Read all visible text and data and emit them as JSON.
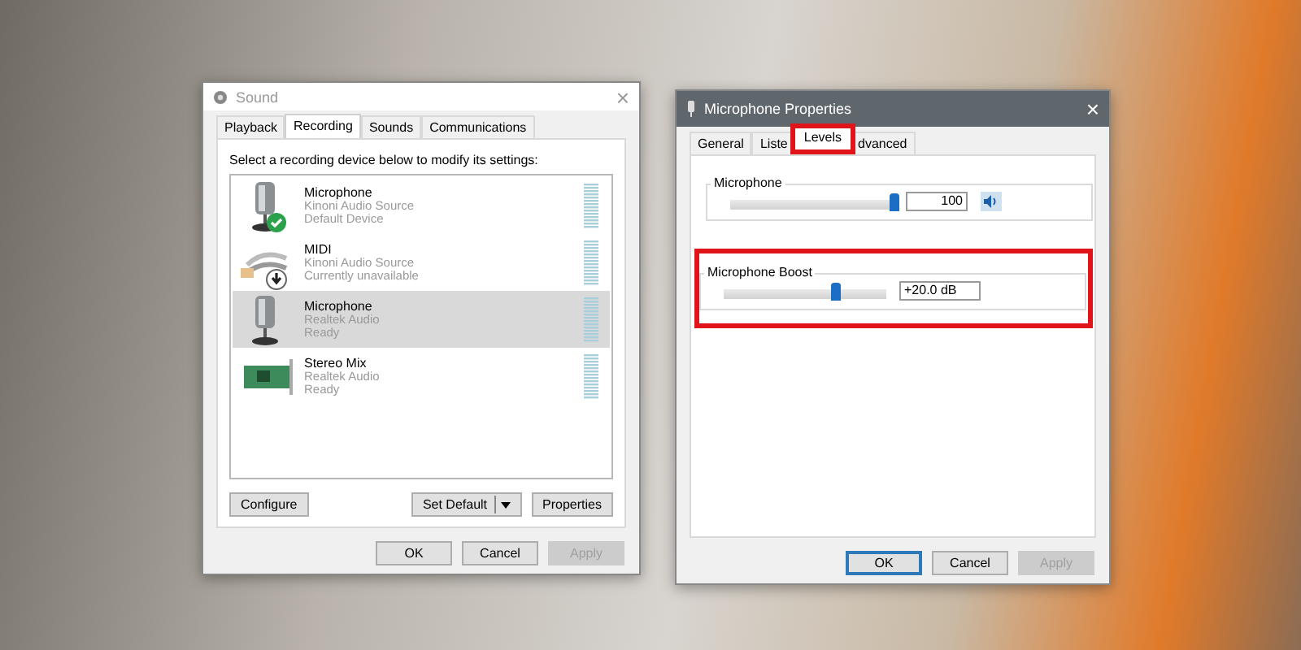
{
  "sound_window": {
    "title": "Sound",
    "close_label": "×",
    "tabs": [
      {
        "label": "Playback",
        "selected": false
      },
      {
        "label": "Recording",
        "selected": true
      },
      {
        "label": "Sounds",
        "selected": false
      },
      {
        "label": "Communications",
        "selected": false
      }
    ],
    "instruction": "Select a recording device below to modify its settings:",
    "devices": [
      {
        "name": "Microphone",
        "source": "Kinoni Audio Source",
        "status": "Default Device",
        "kind": "microphone",
        "default": true,
        "unavailable": false,
        "selected": false
      },
      {
        "name": "MIDI",
        "source": "Kinoni Audio Source",
        "status": "Currently unavailable",
        "kind": "midi",
        "default": false,
        "unavailable": true,
        "selected": false
      },
      {
        "name": "Microphone",
        "source": "Realtek Audio",
        "status": "Ready",
        "kind": "microphone",
        "default": false,
        "unavailable": false,
        "selected": true
      },
      {
        "name": "Stereo Mix",
        "source": "Realtek Audio",
        "status": "Ready",
        "kind": "card",
        "default": false,
        "unavailable": false,
        "selected": false
      }
    ],
    "device_buttons": [
      {
        "label": "Configure",
        "kind": "plain"
      },
      {
        "label": "Set Default",
        "kind": "split"
      },
      {
        "label": "Properties",
        "kind": "plain"
      }
    ],
    "dialog_buttons": [
      {
        "label": "OK",
        "disabled": false
      },
      {
        "label": "Cancel",
        "disabled": false
      },
      {
        "label": "Apply",
        "disabled": true
      }
    ]
  },
  "properties_window": {
    "title": "Microphone Properties",
    "close_label": "×",
    "tabs": [
      {
        "label": "General",
        "selected": false,
        "highlighted": false
      },
      {
        "label": "Liste",
        "selected": false,
        "highlighted": false
      },
      {
        "label": "Levels",
        "selected": true,
        "highlighted": true
      },
      {
        "label": "dvanced",
        "selected": false,
        "highlighted": false
      }
    ],
    "levels": [
      {
        "label": "Microphone",
        "kind": "volume",
        "level": 1.0,
        "value": "100",
        "highlighted": false
      },
      {
        "label": "Microphone Boost",
        "kind": "boost",
        "level": 0.67,
        "value": "+20.0 dB",
        "highlighted": true
      }
    ],
    "dialog_buttons": [
      {
        "label": "OK",
        "disabled": false,
        "focused": true
      },
      {
        "label": "Cancel",
        "disabled": false,
        "focused": false
      },
      {
        "label": "Apply",
        "disabled": true,
        "focused": false
      }
    ]
  }
}
